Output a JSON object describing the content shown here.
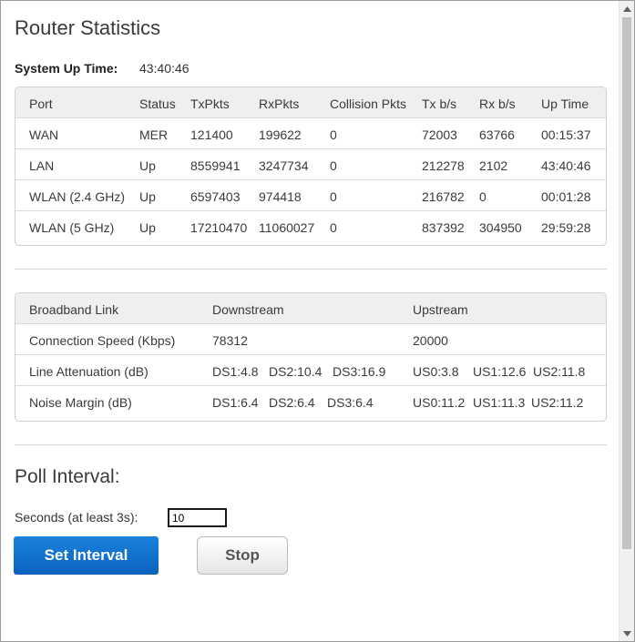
{
  "page": {
    "title": "Router Statistics",
    "uptime_label": "System Up Time:",
    "uptime_value": "43:40:46"
  },
  "port_table": {
    "headers": [
      "Port",
      "Status",
      "TxPkts",
      "RxPkts",
      "Collision Pkts",
      "Tx b/s",
      "Rx b/s",
      "Up Time"
    ],
    "rows": [
      [
        "WAN",
        "MER",
        "121400",
        "199622",
        "0",
        "72003",
        "63766",
        "00:15:37"
      ],
      [
        "LAN",
        "Up",
        "8559941",
        "3247734",
        "0",
        "212278",
        "2102",
        "43:40:46"
      ],
      [
        "WLAN (2.4 GHz)",
        "Up",
        "6597403",
        "974418",
        "0",
        "216782",
        "0",
        "00:01:28"
      ],
      [
        "WLAN (5 GHz)",
        "Up",
        "17210470",
        "11060027",
        "0",
        "837392",
        "304950",
        "29:59:28"
      ]
    ]
  },
  "broadband_table": {
    "headers": [
      "Broadband Link",
      "Downstream",
      "Upstream"
    ],
    "rows": [
      {
        "label": "Connection Speed (Kbps)",
        "down": [
          "78312"
        ],
        "up": [
          "20000"
        ]
      },
      {
        "label": "Line Attenuation (dB)",
        "down": [
          "DS1:4.8",
          "DS2:10.4",
          "DS3:16.9"
        ],
        "up": [
          "US0:3.8",
          "US1:12.6",
          "US2:11.8"
        ]
      },
      {
        "label": "Noise Margin (dB)",
        "down": [
          "DS1:6.4",
          "DS2:6.4",
          "DS3:6.4"
        ],
        "up": [
          "US0:11.2",
          "US1:11.3",
          "US2:11.2"
        ]
      }
    ]
  },
  "poll": {
    "title": "Poll Interval:",
    "seconds_label": "Seconds (at least 3s):",
    "seconds_value": "10",
    "set_label": "Set Interval",
    "stop_label": "Stop"
  },
  "icons": {
    "scroll_up": "scroll-up-arrow-icon",
    "scroll_down": "scroll-down-arrow-icon"
  },
  "colors": {
    "primary_button": "#0a6fd0",
    "header_bg": "#efefef"
  }
}
